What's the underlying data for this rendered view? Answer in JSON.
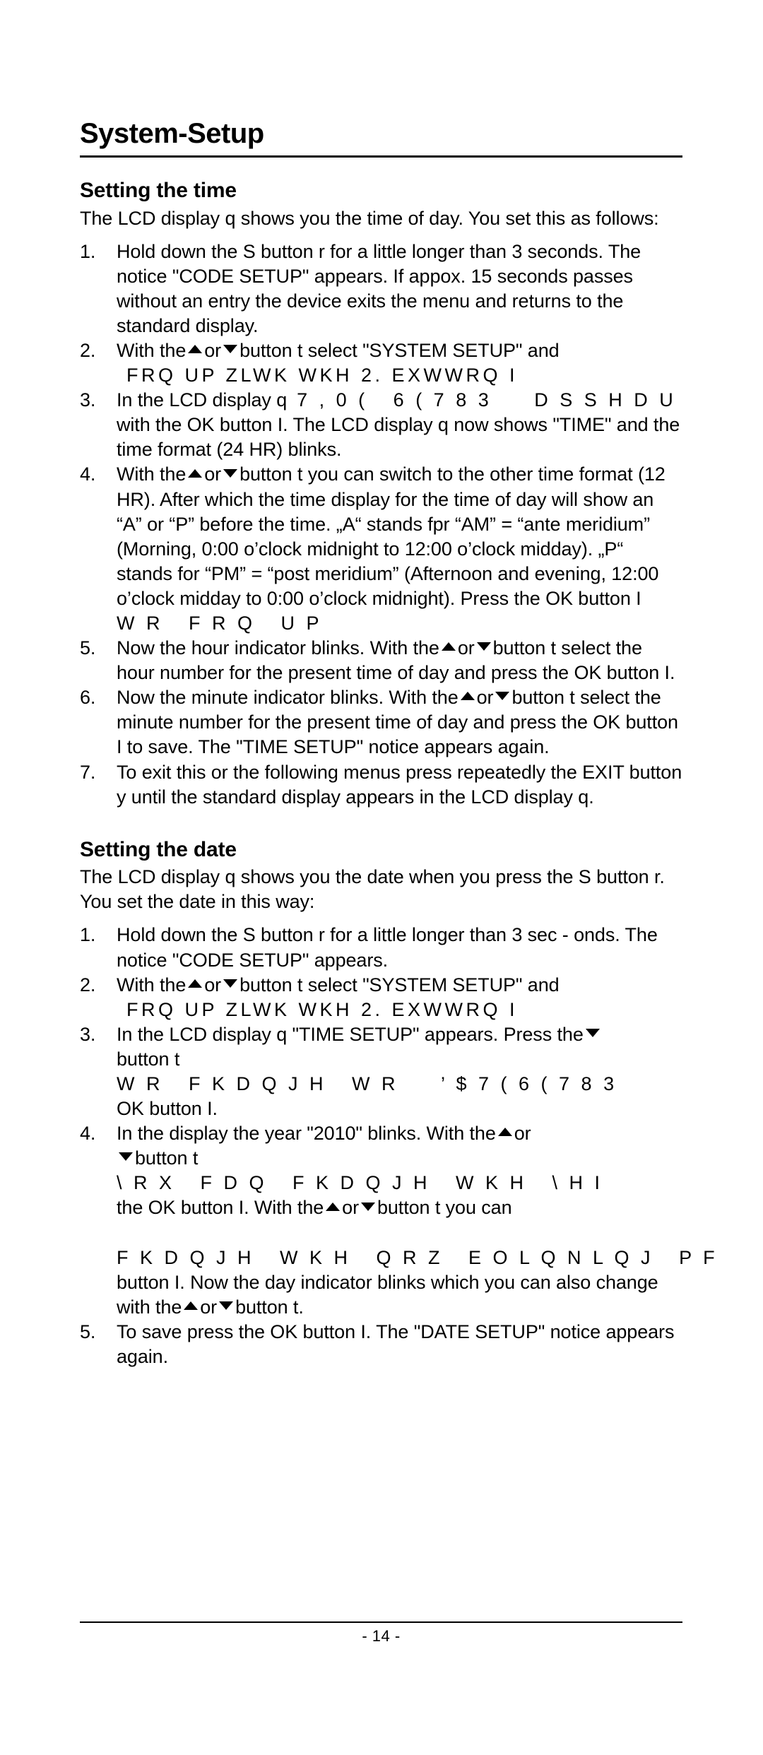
{
  "document": {
    "title": "System-Setup",
    "page_number": "- 14 -"
  },
  "time_section": {
    "heading": "Setting the time",
    "intro": "The LCD display q shows you the time of day. You set this as follows:",
    "steps": [
      {
        "num": "1.",
        "text": "Hold down the S button r for a little longer than 3 seconds. The notice \"CODE SETUP\" appears. If appox. 15 seconds passes without an entry the device exits the menu and returns to the standard display."
      },
      {
        "num": "2.",
        "text_before": "With the",
        "text_mid": "or",
        "text_after": "button t select \"SYSTEM SETUP\" and",
        "encoded": "FRQ UP ZLWK WKH 2. EXWWRQ I"
      },
      {
        "num": "3.",
        "text_before": "In the LCD display q",
        "encoded": "7 , 0 (   6 ( 7 8 3     D S S H D U",
        "text_after": "with the OK button I. The LCD display q now shows \"TIME\" and the time format (24 HR) blinks."
      },
      {
        "num": "4.",
        "text_before": "With the",
        "text_mid": "or",
        "text_after": "button t you can switch to the other time format (12 HR). After which the time display for the time of day will show an “A” or “P” before the time. „A“ stands fpr “AM” = “ante meridium” (Morning, 0:00 o’clock midnight to 12:00 o’clock midday). „P“ stands for “PM” = “post meridium” (Afternoon and evening, 12:00 o’clock midday to 0:00 o’clock midnight). Press the OK button I",
        "encoded": "W R   F R Q   U P"
      },
      {
        "num": "5.",
        "text_before": "Now the hour indicator blinks. With the",
        "text_mid": "or",
        "text_after": "button t select the hour number for the present time of day and press the OK button I."
      },
      {
        "num": "6.",
        "text_before": "Now the minute indicator blinks. With the",
        "text_mid": "or",
        "text_after": "button t select the minute number for the present time of day and press the OK button I to save. The \"TIME SETUP\" notice appears again."
      },
      {
        "num": "7.",
        "text": "To exit this or the following menus press repeatedly the EXIT button y until the standard display appears in the LCD display q."
      }
    ]
  },
  "date_section": {
    "heading": "Setting the date",
    "intro": "The LCD display q shows you the date when you press the S button r. You set the date in this way:",
    "steps": [
      {
        "num": "1.",
        "text": "Hold down the S button r for a little longer than 3 sec - onds. The notice \"CODE SETUP\" appears."
      },
      {
        "num": "2.",
        "text_before": "With the",
        "text_mid": "or",
        "text_after": "button t select \"SYSTEM SETUP\" and",
        "encoded": "FRQ UP ZLWK WKH 2. EXWWRQ I"
      },
      {
        "num": "3.",
        "text_before": "In the LCD display q \"TIME SETUP\" appears. Press the",
        "text_after_arrow": "button t",
        "encoded": "W R   F K D Q J H   W R     ’ $ 7 ( 6 ( 7 8 3",
        "text_end": "OK button I."
      },
      {
        "num": "4.",
        "text_before": "In the display the year \"2010\" blinks. With the",
        "text_mid": "or",
        "text_arrow_line": "button t",
        "encoded_1": "\\ R X   F D Q   F K D Q J H   W K H   \\ H I",
        "text_mid_2": "the OK button I. With the",
        "text_mid_3": "or",
        "text_mid_4": "button t you can",
        "encoded_2": "F K D Q J H   W K H   Q R Z   E O L Q N L Q J   P F",
        "text_end": "button I. Now the day indicator blinks which you can also change with the",
        "text_mid_5": "or",
        "text_end_2": "button t."
      },
      {
        "num": "5.",
        "text": "To save press the OK button I. The \"DATE SETUP\" notice appears again."
      }
    ]
  }
}
